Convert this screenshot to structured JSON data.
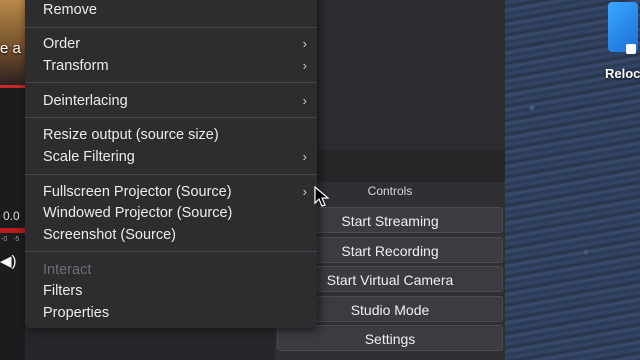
{
  "context_menu": {
    "items": [
      {
        "label": "Remove"
      },
      {
        "label": "Order"
      },
      {
        "label": "Transform"
      },
      {
        "label": "Deinterlacing"
      },
      {
        "label": "Resize output (source size)"
      },
      {
        "label": "Scale Filtering"
      },
      {
        "label": "Fullscreen Projector (Source)"
      },
      {
        "label": "Windowed Projector (Source)"
      },
      {
        "label": "Screenshot (Source)"
      },
      {
        "label": "Interact"
      },
      {
        "label": "Filters"
      },
      {
        "label": "Properties"
      }
    ],
    "submenu_glyph": "›"
  },
  "controls": {
    "title": "Controls",
    "buttons": [
      {
        "label": "Start Streaming"
      },
      {
        "label": "Start Recording"
      },
      {
        "label": "Start Virtual Camera"
      },
      {
        "label": "Studio Mode"
      },
      {
        "label": "Settings"
      }
    ]
  },
  "left_panel": {
    "preview_text": "e a",
    "audio_value": "0.0",
    "meter_ticks": [
      "-0",
      "-5"
    ],
    "speaker_glyph": "◀)"
  },
  "desktop": {
    "icon_label": "Reloc"
  },
  "colors": {
    "menu_bg": "#2d2d30",
    "menu_text": "#ececec",
    "disabled_text": "#6d6d72",
    "button_bg": "#3a3c41",
    "desktop_ocean": "#2b3a52"
  }
}
